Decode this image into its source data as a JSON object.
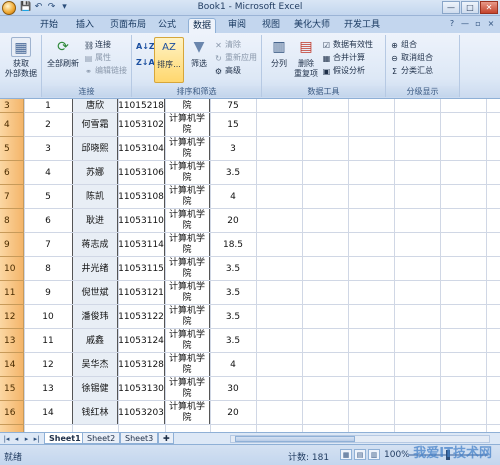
{
  "window": {
    "title": "Book1 - Microsoft Excel",
    "controls": [
      "—",
      "□",
      "✕"
    ]
  },
  "quick_access": [
    "💾",
    "↶",
    "↷",
    "▾"
  ],
  "tabs": [
    "开始",
    "插入",
    "页面布局",
    "公式",
    "数据",
    "审阅",
    "视图",
    "美化大师",
    "开发工具"
  ],
  "active_tab": "数据",
  "ribbon": {
    "get_external": {
      "label": "获取\n外部数据",
      "label1": "获取",
      "label2": "外部数据"
    },
    "connections": {
      "refresh_all": "全部刷新",
      "connect": "连接",
      "properties": "属性",
      "edit_links": "编辑链接",
      "group_label": "连接"
    },
    "sort_filter": {
      "sort_az": "A↓Z",
      "sort_za": "Z↓A",
      "sort": "排序...",
      "filter": "筛选",
      "clear": "清除",
      "reapply": "重新应用",
      "advanced": "高级",
      "group_label": "排序和筛选"
    },
    "data_tools": {
      "text_to_columns": "分列",
      "remove_dup1": "删除",
      "remove_dup2": "重复项",
      "validation": "数据有效性",
      "consolidate": "合并计算",
      "what_if": "假设分析",
      "group_label": "数据工具"
    },
    "outline": {
      "group": "组合",
      "ungroup": "取消组合",
      "subtotal": "分类汇总",
      "group_label": "分级显示"
    }
  },
  "rows": [
    {
      "row": "3",
      "no": "1",
      "name": "唐欣",
      "id": "11015218",
      "dept": "院",
      "score": "75",
      "partial": true
    },
    {
      "row": "4",
      "no": "2",
      "name": "何雪霜",
      "id": "11053102",
      "dept": "计算机学院",
      "score": "15"
    },
    {
      "row": "5",
      "no": "3",
      "name": "邱晓熙",
      "id": "11053104",
      "dept": "计算机学院",
      "score": "3"
    },
    {
      "row": "6",
      "no": "4",
      "name": "苏娜",
      "id": "11053106",
      "dept": "计算机学院",
      "score": "3.5"
    },
    {
      "row": "7",
      "no": "5",
      "name": "陈凯",
      "id": "11053108",
      "dept": "计算机学院",
      "score": "4"
    },
    {
      "row": "8",
      "no": "6",
      "name": "耿进",
      "id": "11053110",
      "dept": "计算机学院",
      "score": "20"
    },
    {
      "row": "9",
      "no": "7",
      "name": "蒋志成",
      "id": "11053114",
      "dept": "计算机学院",
      "score": "18.5"
    },
    {
      "row": "10",
      "no": "8",
      "name": "井光绪",
      "id": "11053115",
      "dept": "计算机学院",
      "score": "3.5"
    },
    {
      "row": "11",
      "no": "9",
      "name": "倪世斌",
      "id": "11053121",
      "dept": "计算机学院",
      "score": "3.5"
    },
    {
      "row": "12",
      "no": "10",
      "name": "潘俊玮",
      "id": "11053122",
      "dept": "计算机学院",
      "score": "3.5"
    },
    {
      "row": "13",
      "no": "11",
      "name": "戚鑫",
      "id": "11053124",
      "dept": "计算机学院",
      "score": "3.5"
    },
    {
      "row": "14",
      "no": "12",
      "name": "吴华杰",
      "id": "11053128",
      "dept": "计算机学院",
      "score": "4"
    },
    {
      "row": "15",
      "no": "13",
      "name": "徐锡健",
      "id": "11053130",
      "dept": "计算机学院",
      "score": "30"
    },
    {
      "row": "16",
      "no": "14",
      "name": "钱红林",
      "id": "11053203",
      "dept": "计算机学院",
      "score": "20"
    }
  ],
  "sheet_tabs": [
    "Sheet1",
    "Sheet2",
    "Sheet3"
  ],
  "active_sheet": "Sheet1",
  "status": {
    "ready": "就绪",
    "count": "计数: 181",
    "zoom": "100%"
  },
  "watermark": "我爱IT技术网"
}
